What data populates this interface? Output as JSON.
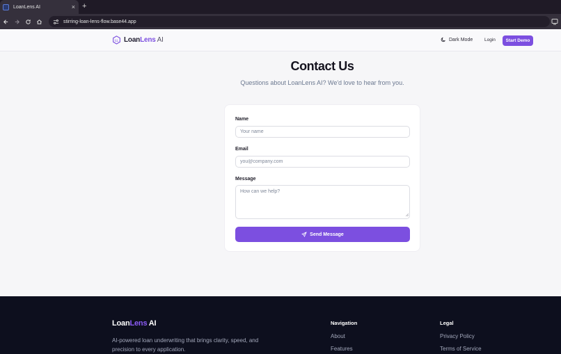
{
  "browser": {
    "tab_title": "LoanLens AI",
    "tab_close": "×",
    "new_tab": "+",
    "url": "stirring-loan-lens-flow.base44.app"
  },
  "header": {
    "logo": {
      "name_part1": "Loan",
      "name_part2": "Lens",
      "name_part3": " AI"
    },
    "dark_mode_label": "Dark Mode",
    "login_label": "Login",
    "start_demo_label": "Start Demo",
    "accent_color": "#7c4fe0"
  },
  "main": {
    "title": "Contact Us",
    "subtitle": "Questions about LoanLens AI? We'd love to hear from you."
  },
  "form": {
    "name_label": "Name",
    "name_placeholder": "Your name",
    "name_value": "",
    "email_label": "Email",
    "email_placeholder": "you@company.com",
    "email_value": "",
    "message_label": "Message",
    "message_placeholder": "How can we help?",
    "message_value": "",
    "submit_label": "Send Message"
  },
  "footer": {
    "logo": {
      "name_part1": "Loan",
      "name_part2": "Lens",
      "name_part3": " AI"
    },
    "description": "AI-powered loan underwriting that brings clarity, speed, and precision to every application.",
    "navigation": {
      "title": "Navigation",
      "links": [
        "About",
        "Features"
      ]
    },
    "legal": {
      "title": "Legal",
      "links": [
        "Privacy Policy",
        "Terms of Service"
      ]
    },
    "background_color": "#0d0f1e"
  }
}
